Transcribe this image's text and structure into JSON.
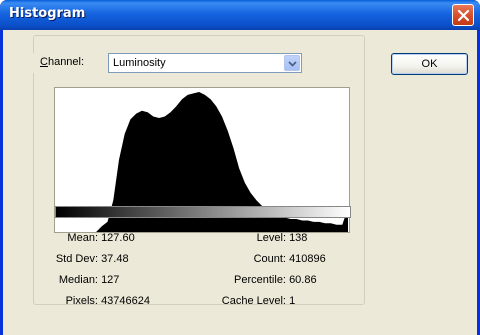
{
  "window": {
    "title": "Histogram"
  },
  "channel": {
    "label_prefix": "",
    "label_accel": "C",
    "label_rest": "hannel:",
    "value": "Luminosity"
  },
  "buttons": {
    "ok": "OK"
  },
  "stats": {
    "mean": {
      "label": "Mean:",
      "value": "127.60"
    },
    "std_dev": {
      "label": "Std Dev:",
      "value": "37.48"
    },
    "median": {
      "label": "Median:",
      "value": "127"
    },
    "pixels": {
      "label": "Pixels:",
      "value": "43746624"
    },
    "level": {
      "label": "Level:",
      "value": "138"
    },
    "count": {
      "label": "Count:",
      "value": "410896"
    },
    "percentile": {
      "label": "Percentile:",
      "value": "60.86"
    },
    "cache_level": {
      "label": "Cache Level:",
      "value": "1"
    }
  },
  "chart_data": {
    "type": "area",
    "title": "",
    "xlabel": "",
    "ylabel": "",
    "xlim": [
      0,
      255
    ],
    "x": [
      0,
      20,
      35,
      40,
      45,
      50,
      55,
      60,
      65,
      70,
      75,
      80,
      85,
      90,
      95,
      100,
      105,
      110,
      115,
      120,
      125,
      130,
      135,
      140,
      145,
      150,
      155,
      160,
      165,
      170,
      175,
      180,
      185,
      190,
      195,
      200,
      205,
      210,
      215,
      220,
      225,
      230,
      235,
      240,
      245,
      250,
      253,
      255
    ],
    "values": [
      0,
      0,
      0,
      4,
      7,
      22,
      50,
      68,
      78,
      82,
      84,
      83,
      80,
      79,
      80,
      83,
      87,
      92,
      95,
      96,
      97,
      95,
      92,
      87,
      80,
      70,
      58,
      44,
      34,
      27,
      22,
      18,
      15,
      12,
      11,
      10,
      9,
      9,
      8,
      8,
      7,
      7,
      6,
      6,
      5,
      5,
      12,
      18
    ]
  },
  "colors": {
    "title_bar": "#0a5fd8",
    "dialog_bg": "#ece9d8",
    "histogram_fill": "#000000"
  },
  "icons": {
    "close": "close-icon",
    "dropdown": "chevron-down-icon"
  }
}
